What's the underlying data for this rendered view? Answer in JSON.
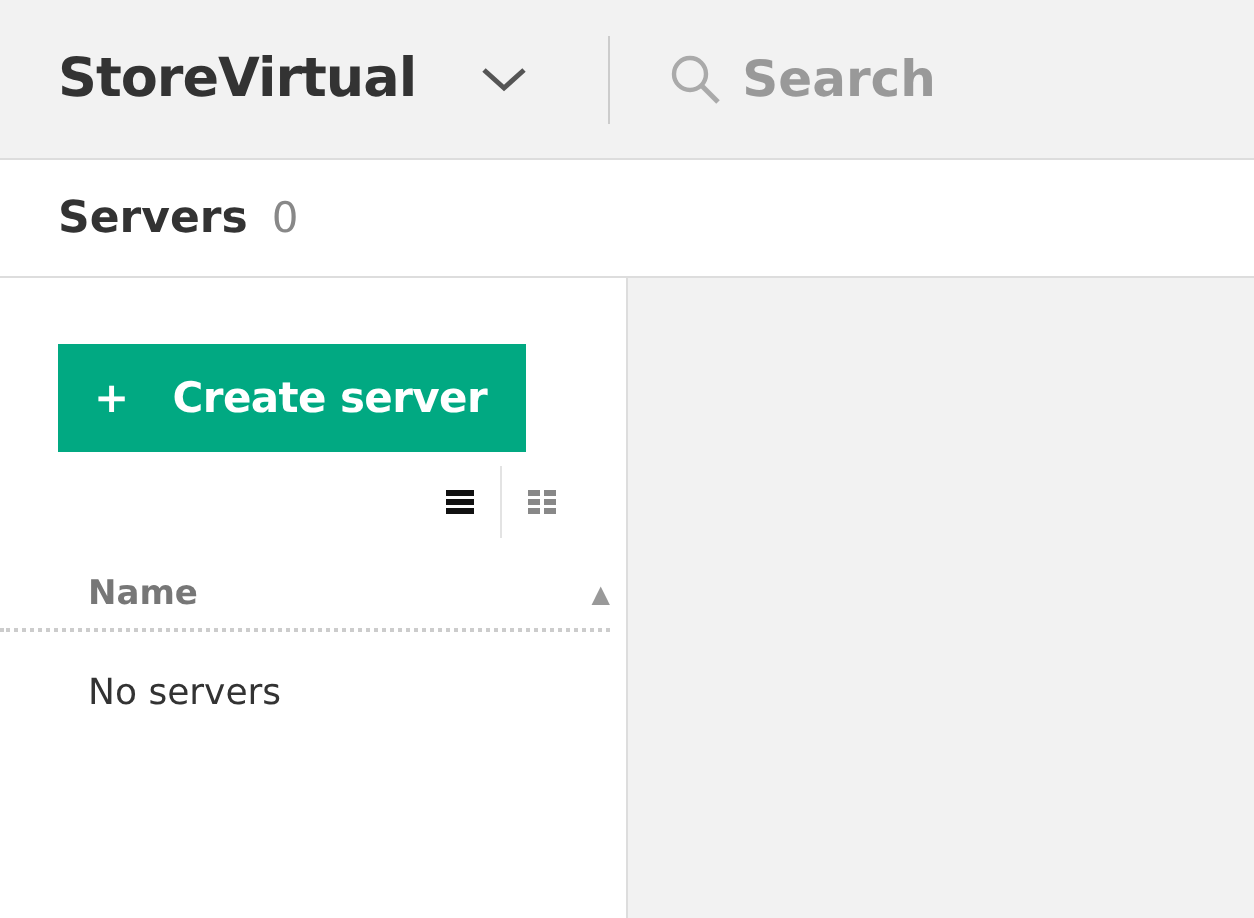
{
  "header": {
    "title": "StoreVirtual",
    "search": {
      "placeholder": "Search"
    }
  },
  "page": {
    "title": "Servers",
    "count": "0"
  },
  "create_button": {
    "icon": "+",
    "label": "Create server"
  },
  "view_toggles": [
    {
      "kind": "list",
      "selected": true
    },
    {
      "kind": "grid",
      "selected": false
    }
  ],
  "table": {
    "columns": [
      {
        "label": "Name",
        "sort_icon": "▲"
      }
    ],
    "empty_message": "No servers"
  }
}
